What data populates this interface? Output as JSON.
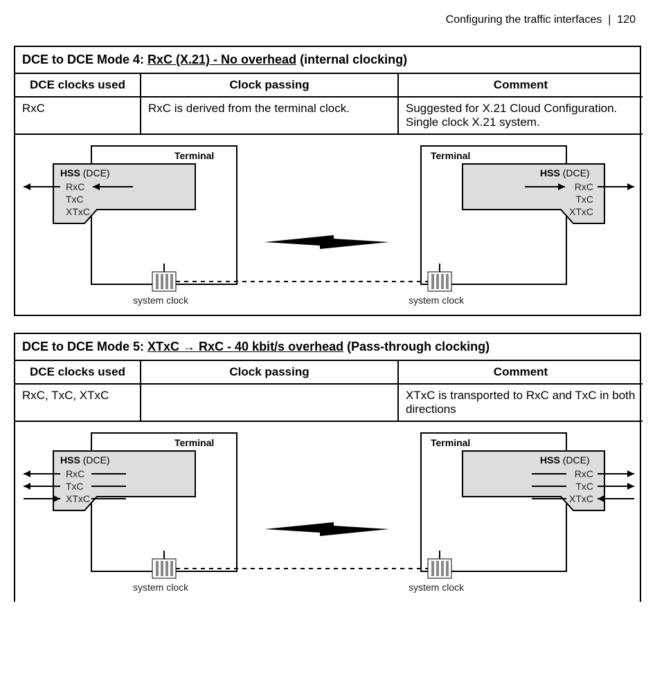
{
  "page_header": {
    "breadcrumb": "Configuring the traffic interfaces",
    "separator": "|",
    "page_number": "120"
  },
  "sections": [
    {
      "title_prefix": "DCE to DCE Mode 4:  ",
      "title_underlined": "RxC (X.21) - No overhead",
      "title_suffix": " (internal clocking)",
      "headers": [
        "DCE clocks used",
        "Clock passing",
        "Comment"
      ],
      "row": {
        "clocks": "RxC",
        "passing": "RxC is derived from the terminal clock.",
        "comment": "Suggested for X.21 Cloud Configuration. Single clock X.21 system."
      },
      "diagram": {
        "terminal_label": "Terminal",
        "hss_label": "HSS",
        "hss_role": "(DCE)",
        "signals": [
          "RxC",
          "TxC",
          "XTxC"
        ],
        "system_clock_label": "system clock",
        "mode": 4
      }
    },
    {
      "title_prefix": "DCE to DCE Mode 5:  ",
      "title_underlined": "XTxC → RxC - 40 kbit/s overhead",
      "title_suffix": " (Pass-through clocking)",
      "headers": [
        "DCE clocks used",
        "Clock passing",
        "Comment"
      ],
      "row": {
        "clocks": "RxC, TxC, XTxC",
        "passing": "",
        "comment": "XTxC is transported to RxC and TxC in both directions"
      },
      "diagram": {
        "terminal_label": "Terminal",
        "hss_label": "HSS",
        "hss_role": "(DCE)",
        "signals": [
          "RxC",
          "TxC",
          "XTxC"
        ],
        "system_clock_label": "system clock",
        "mode": 5
      }
    }
  ]
}
